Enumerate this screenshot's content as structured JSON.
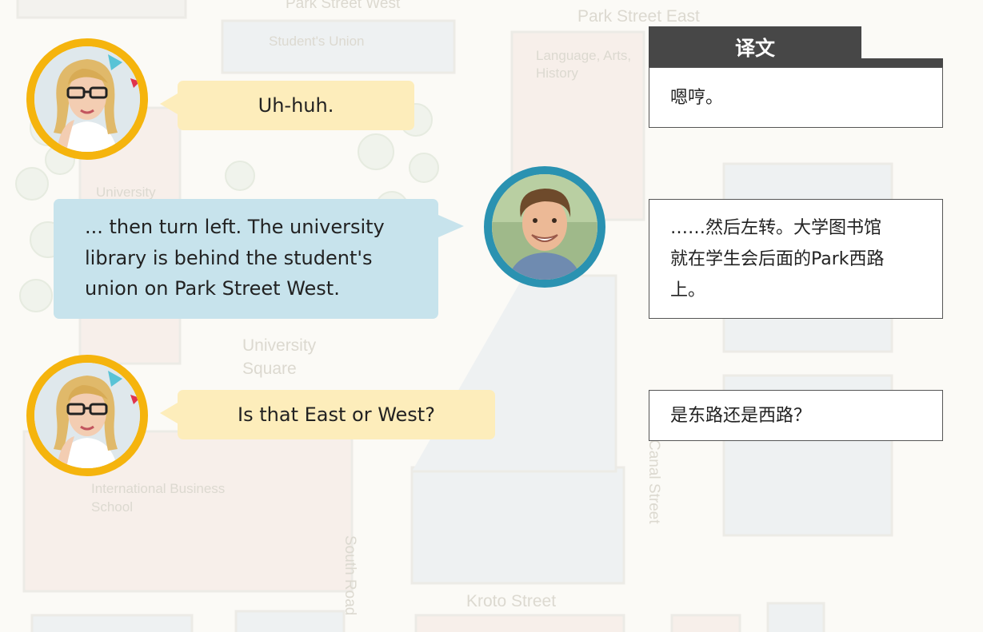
{
  "map": {
    "labels": [
      "Park Street West",
      "Park Street East",
      "Student's Union",
      "Language, Arts,",
      "History",
      "University",
      "University",
      "Square",
      "International Business",
      "School",
      "South Road",
      "Canal Street",
      "Kroto Street"
    ]
  },
  "dialogue": [
    {
      "speaker": "woman",
      "text": "Uh-huh."
    },
    {
      "speaker": "man",
      "lines": [
        "... then turn left. The university",
        "library is behind the student's",
        "union on Park Street West."
      ]
    },
    {
      "speaker": "woman",
      "text": "Is that East or West?"
    }
  ],
  "translation": {
    "header": "译文",
    "items": [
      {
        "lines": [
          "嗯哼。"
        ]
      },
      {
        "lines": [
          "……然后左转。大学图书馆",
          "就在学生会后面的Park西路",
          "上。"
        ]
      },
      {
        "lines": [
          "是东路还是西路？"
        ]
      }
    ]
  },
  "colors": {
    "woman_ring": "#f5b40d",
    "man_ring": "#2a92b1",
    "yellow_bubble": "#fdedbb",
    "blue_bubble": "#c7e3ec",
    "header_bg": "#474747"
  },
  "icons": [
    "woman-avatar",
    "man-avatar"
  ]
}
